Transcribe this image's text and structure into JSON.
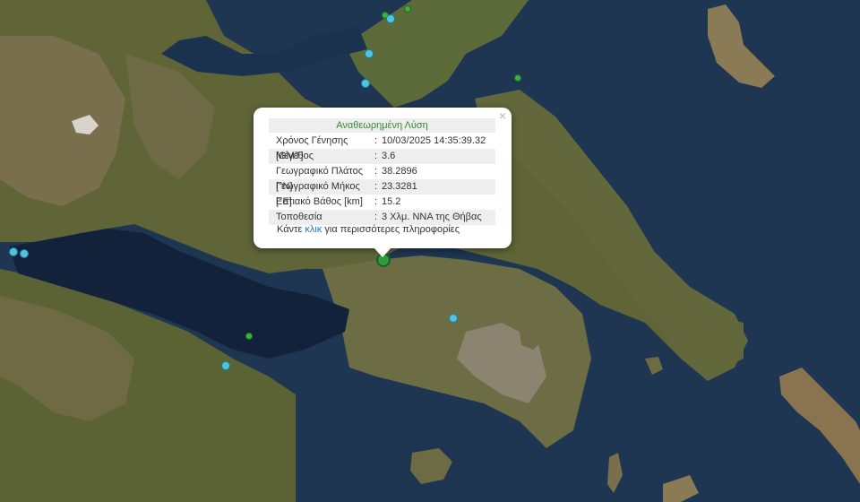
{
  "popup": {
    "title": "Αναθεωρημένη Λύση",
    "close_label": "×",
    "rows": [
      {
        "label": "Χρόνος Γένησης [GMT]",
        "sep": ":",
        "value": "10/03/2025 14:35:39.32"
      },
      {
        "label": "Μέγεθος",
        "sep": ":",
        "value": "3.6"
      },
      {
        "label": "Γεωγραφικό Πλάτος [°N]",
        "sep": ":",
        "value": "38.2896"
      },
      {
        "label": "Γεωγραφικό Μήκος [°E]",
        "sep": ":",
        "value": "23.3281"
      },
      {
        "label": "Εστιακό Βάθος [km]",
        "sep": ":",
        "value": "15.2"
      },
      {
        "label": "Τοποθεσία",
        "sep": ":",
        "value": "3 Χλμ. ΝΝΑ της Θήβας"
      }
    ],
    "more_prefix": "Κάντε",
    "more_link": "κλικ",
    "more_suffix": "για περισσότερες πληροφορίες"
  },
  "colors": {
    "sea": "#1d3550",
    "land": "#6b6a3e",
    "marker_recent": "#3cb043",
    "marker_older": "#4fc3e0",
    "link": "#2176c7",
    "title": "#2e8b33"
  }
}
